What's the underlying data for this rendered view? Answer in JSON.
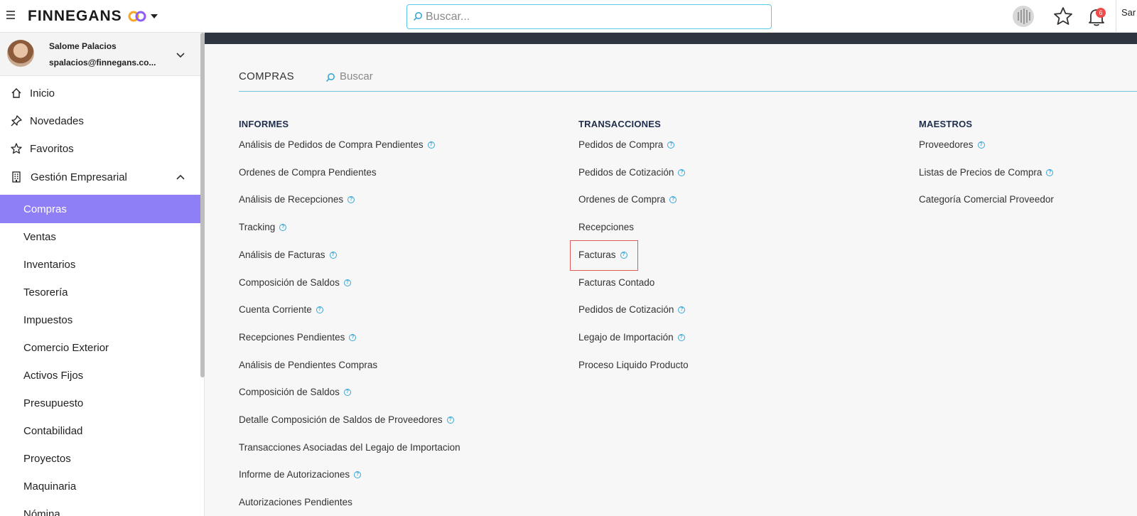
{
  "topbar": {
    "brand": "FINNEGANS",
    "search_placeholder": "Buscar...",
    "notification_count": "6",
    "user_truncated": "Sar"
  },
  "profile": {
    "name": "Salome Palacios",
    "email": "spalacios@finnegans.co..."
  },
  "nav": {
    "inicio": "Inicio",
    "novedades": "Novedades",
    "favoritos": "Favoritos",
    "gestion": "Gestión Empresarial"
  },
  "modules": [
    "Compras",
    "Ventas",
    "Inventarios",
    "Tesorería",
    "Impuestos",
    "Comercio Exterior",
    "Activos Fijos",
    "Presupuesto",
    "Contabilidad",
    "Proyectos",
    "Maquinaria",
    "Nómina"
  ],
  "section": {
    "title": "COMPRAS",
    "search_label": "Buscar"
  },
  "columns": {
    "informes": {
      "title": "INFORMES",
      "items": [
        {
          "label": "Análisis de Pedidos de Compra Pendientes",
          "help": true
        },
        {
          "label": "Ordenes de Compra Pendientes",
          "help": false
        },
        {
          "label": "Análisis de Recepciones",
          "help": true
        },
        {
          "label": "Tracking",
          "help": true
        },
        {
          "label": "Análisis de Facturas",
          "help": true
        },
        {
          "label": "Composición de Saldos",
          "help": true
        },
        {
          "label": "Cuenta Corriente",
          "help": true
        },
        {
          "label": "Recepciones Pendientes",
          "help": true
        },
        {
          "label": "Análisis de Pendientes Compras",
          "help": false
        },
        {
          "label": "Composición de Saldos",
          "help": true
        },
        {
          "label": "Detalle Composición de Saldos de Proveedores",
          "help": true
        },
        {
          "label": "Transacciones Asociadas del Legajo de Importacion",
          "help": false
        },
        {
          "label": "Informe de Autorizaciones",
          "help": true
        },
        {
          "label": "Autorizaciones Pendientes",
          "help": false
        }
      ]
    },
    "transacciones": {
      "title": "TRANSACCIONES",
      "items": [
        {
          "label": "Pedidos de Compra",
          "help": true
        },
        {
          "label": "Pedidos de Cotización",
          "help": true
        },
        {
          "label": "Ordenes de Compra",
          "help": true
        },
        {
          "label": "Recepciones",
          "help": false
        },
        {
          "label": "Facturas",
          "help": true
        },
        {
          "label": "Facturas Contado",
          "help": false
        },
        {
          "label": "Pedidos de Cotización",
          "help": true
        },
        {
          "label": "Legajo de Importación",
          "help": true
        },
        {
          "label": "Proceso Liquido Producto",
          "help": false
        }
      ]
    },
    "maestros": {
      "title": "MAESTROS",
      "items": [
        {
          "label": "Proveedores",
          "help": true
        },
        {
          "label": "Listas de Precios de Compra",
          "help": true
        },
        {
          "label": "Categoría Comercial Proveedor",
          "help": false
        }
      ]
    }
  },
  "help_glyph": "?",
  "colors": {
    "active_module": "#8f7ff7",
    "accent": "#3aa7d6",
    "highlight": "#e05a5a",
    "dark_bar": "#2e3440"
  }
}
